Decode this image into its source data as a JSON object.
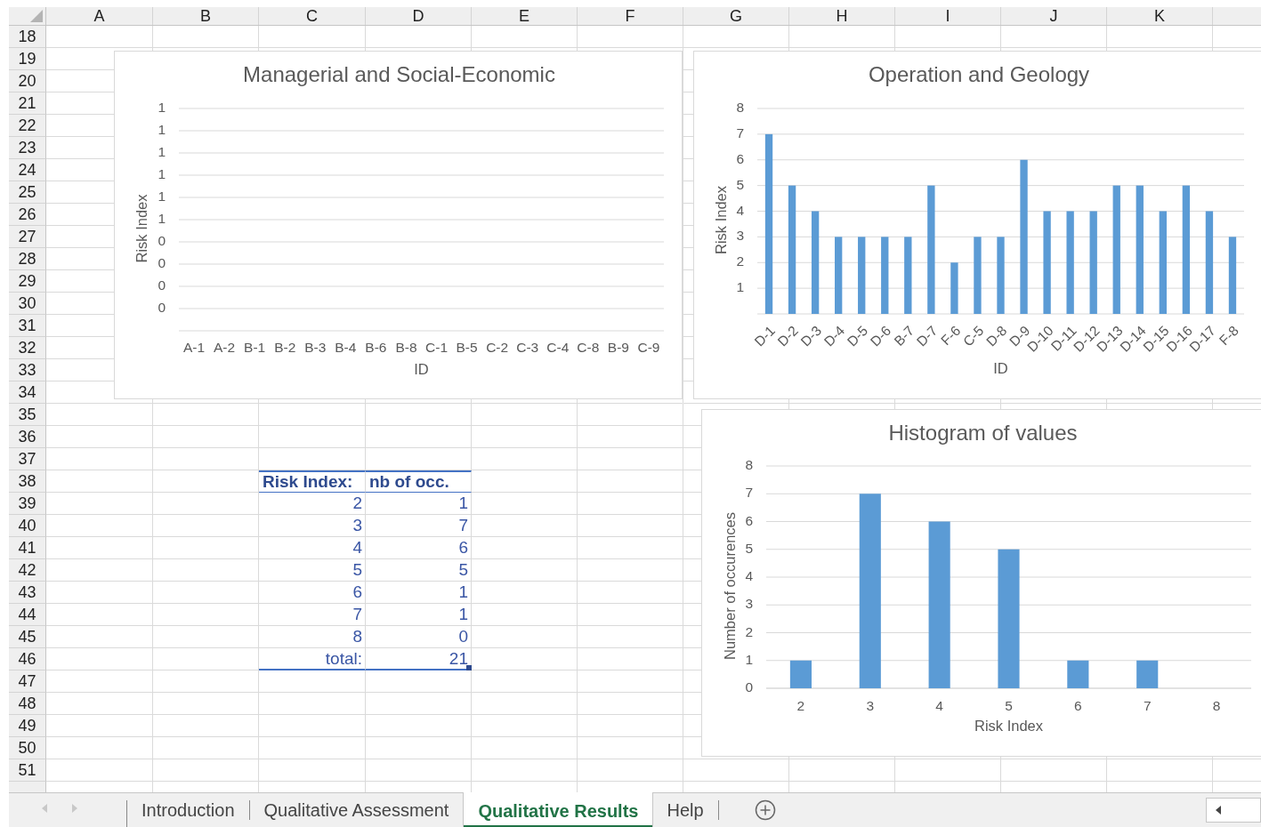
{
  "column_headers": [
    "A",
    "B",
    "C",
    "D",
    "E",
    "F",
    "G",
    "H",
    "I",
    "J",
    "K"
  ],
  "row_numbers": [
    "18",
    "19",
    "20",
    "21",
    "22",
    "23",
    "24",
    "25",
    "26",
    "27",
    "28",
    "29",
    "30",
    "31",
    "32",
    "33",
    "34",
    "35",
    "36",
    "37",
    "38",
    "39",
    "40",
    "41",
    "42",
    "43",
    "44",
    "45",
    "46",
    "47",
    "48",
    "49",
    "50",
    "51"
  ],
  "charts": [
    {
      "chart_data": {
        "type": "bar",
        "title": "Managerial and Social-Economic",
        "xlabel": "ID",
        "ylabel": "Risk Index",
        "categories": [
          "A-1",
          "A-2",
          "B-1",
          "B-2",
          "B-3",
          "B-4",
          "B-6",
          "B-8",
          "C-1",
          "B-5",
          "C-2",
          "C-3",
          "C-4",
          "C-8",
          "B-9",
          "C-9"
        ],
        "series": [
          {
            "values": [
              null,
              null,
              null,
              null,
              null,
              null,
              null,
              null,
              null,
              null,
              null,
              null,
              null,
              null,
              null,
              null
            ]
          }
        ],
        "grid": true,
        "ylim": [
          0,
          1
        ],
        "yticks": [
          {
            "value": 0.1,
            "label": "0"
          },
          {
            "value": 0.2,
            "label": "0"
          },
          {
            "value": 0.3,
            "label": "0"
          },
          {
            "value": 0.4,
            "label": "0"
          },
          {
            "value": 0.5,
            "label": "1"
          },
          {
            "value": 0.6,
            "label": "1"
          },
          {
            "value": 0.7,
            "label": "1"
          },
          {
            "value": 0.8,
            "label": "1"
          },
          {
            "value": 0.9,
            "label": "1"
          },
          {
            "value": 1,
            "label": "1"
          }
        ]
      }
    },
    {
      "chart_data": {
        "type": "bar",
        "title": "Operation and Geology",
        "xlabel": "ID",
        "ylabel": "Risk Index",
        "categories": [
          "D-1",
          "D-2",
          "D-3",
          "D-4",
          "D-5",
          "D-6",
          "B-7",
          "D-7",
          "F-6",
          "C-5",
          "D-8",
          "D-9",
          "D-10",
          "D-11",
          "D-12",
          "D-13",
          "D-14",
          "D-15",
          "D-16",
          "D-17",
          "F-8"
        ],
        "series": [
          {
            "color": "#5b9bd5",
            "values": [
              7,
              5,
              4,
              3,
              3,
              3,
              3,
              5,
              2,
              3,
              3,
              6,
              4,
              4,
              4,
              5,
              5,
              4,
              5,
              4,
              3
            ]
          }
        ],
        "ylim": [
          0,
          8
        ],
        "yticks": [
          1,
          2,
          3,
          4,
          5,
          6,
          7,
          8
        ],
        "grid": true
      }
    },
    {
      "chart_data": {
        "type": "bar",
        "title": "Histogram of values",
        "xlabel": "Risk Index",
        "ylabel": "Number of occurences",
        "categories": [
          "2",
          "3",
          "4",
          "5",
          "6",
          "7",
          "8"
        ],
        "series": [
          {
            "color": "#5b9bd5",
            "values": [
              1,
              7,
              6,
              5,
              1,
              1,
              0
            ]
          }
        ],
        "ylim": [
          0,
          8
        ],
        "yticks": [
          0,
          1,
          2,
          3,
          4,
          5,
          6,
          7,
          8
        ],
        "grid": true
      }
    }
  ],
  "risk_table": {
    "headers": [
      "Risk Index:",
      "nb of occ."
    ],
    "rows": [
      {
        "risk_index": "2",
        "occurrences": "1"
      },
      {
        "risk_index": "3",
        "occurrences": "7"
      },
      {
        "risk_index": "4",
        "occurrences": "6"
      },
      {
        "risk_index": "5",
        "occurrences": "5"
      },
      {
        "risk_index": "6",
        "occurrences": "1"
      },
      {
        "risk_index": "7",
        "occurrences": "1"
      },
      {
        "risk_index": "8",
        "occurrences": "0"
      }
    ],
    "total_label": "total:",
    "total": "21"
  },
  "sheet_tabs": [
    {
      "label": "Introduction",
      "selected": false
    },
    {
      "label": "Qualitative Assessment",
      "selected": false
    },
    {
      "label": "Qualitative Results",
      "selected": true
    },
    {
      "label": "Help",
      "selected": false
    }
  ]
}
